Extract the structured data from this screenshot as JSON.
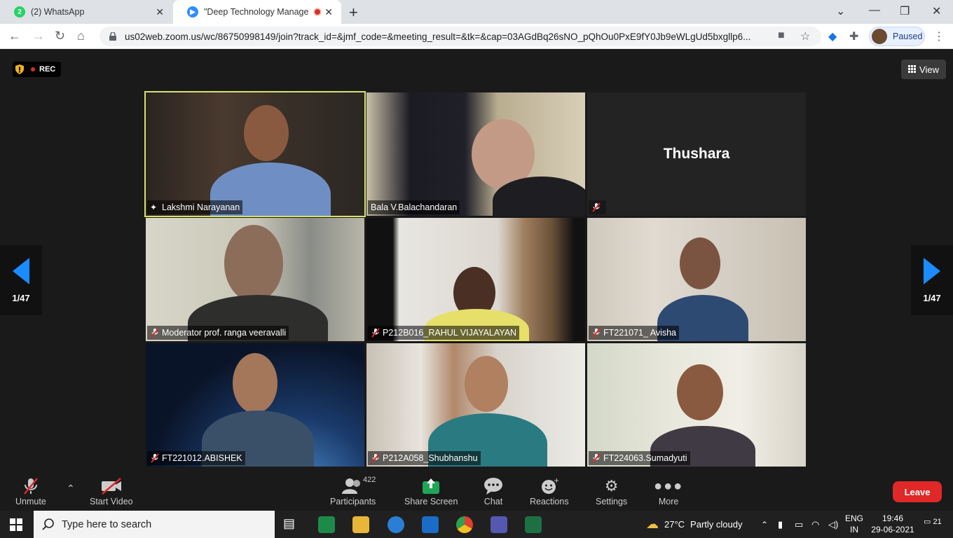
{
  "browser": {
    "tabs": [
      {
        "favicon_text": "2",
        "title": "(2) WhatsApp",
        "active": false
      },
      {
        "favicon_text": "",
        "title": "\"Deep Technology Managem",
        "active": true
      }
    ],
    "url": "us02web.zoom.us/wc/86750998149/join?track_id=&jmf_code=&meeting_result=&tk=&cap=03AGdBq26sNO_pQhOu0PxE9fY0Jb9eWLgUd5bxgllp6...",
    "profile_label": "Paused",
    "colors": {
      "tab_strip": "#dee1e6",
      "whatsapp": "#25d366",
      "zoom_blue": "#2d8cff"
    }
  },
  "meeting": {
    "rec_label": "REC",
    "view_label": "View",
    "page_indicator": "1/47",
    "participants": [
      {
        "name": "Lakshmi Narayanan",
        "speaking": true,
        "muted": false,
        "video": true
      },
      {
        "name": "Bala V.Balachandaran",
        "speaking": false,
        "muted": false,
        "video": true
      },
      {
        "name": "Thushara",
        "speaking": false,
        "muted": true,
        "video": false
      },
      {
        "name": "Moderator prof. ranga veeravalli",
        "speaking": false,
        "muted": true,
        "video": true
      },
      {
        "name": "P212B016_RAHUL VIJAYALAYAN",
        "speaking": false,
        "muted": true,
        "video": true
      },
      {
        "name": "FT221071_ Avisha",
        "speaking": false,
        "muted": true,
        "video": true
      },
      {
        "name": "FT221012.ABISHEK",
        "speaking": false,
        "muted": true,
        "video": true
      },
      {
        "name": "P212A058_Shubhanshu",
        "speaking": false,
        "muted": true,
        "video": true
      },
      {
        "name": "FT224063.Sumadyuti",
        "speaking": false,
        "muted": true,
        "video": true
      }
    ],
    "colors": {
      "speaker_border": "#d7e36d",
      "arrow": "#1a8cff",
      "leave": "#e02828",
      "muted": "#e02828"
    }
  },
  "controls": {
    "unmute": "Unmute",
    "start_video": "Start Video",
    "participants": "Participants",
    "participants_count": "422",
    "share_screen": "Share Screen",
    "chat": "Chat",
    "reactions": "Reactions",
    "settings": "Settings",
    "more": "More",
    "leave": "Leave"
  },
  "taskbar": {
    "search_placeholder": "Type here to search",
    "weather_temp": "27°C",
    "weather_desc": "Partly cloudy",
    "lang_top": "ENG",
    "lang_bottom": "IN",
    "time": "19:46",
    "date": "29-06-2021",
    "notification_count": "21"
  }
}
